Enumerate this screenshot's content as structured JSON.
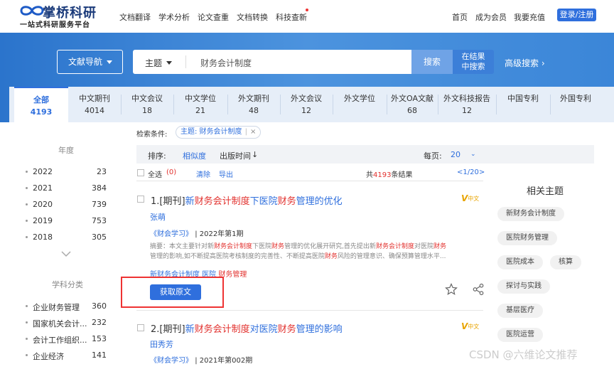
{
  "brand": {
    "name": "掌桥科研",
    "slogan": "一站式科研服务平台"
  },
  "nav": {
    "items": [
      "文档翻译",
      "学术分析",
      "论文查重",
      "文档转换",
      "科技查新"
    ],
    "right": [
      "首页",
      "成为会员",
      "我要充值"
    ],
    "login": "登录/注册"
  },
  "search": {
    "doc_nav": "文献导航",
    "field": "主题",
    "value": "财务会计制度",
    "search_btn": "搜索",
    "in_result_line1": "在结果",
    "in_result_line2": "中搜索",
    "advanced": "高级搜索"
  },
  "tabs": [
    {
      "label": "全部",
      "count": "4193"
    },
    {
      "label": "中文期刊",
      "count": "4014"
    },
    {
      "label": "中文会议",
      "count": "18"
    },
    {
      "label": "中文学位",
      "count": "21"
    },
    {
      "label": "外文期刊",
      "count": "48"
    },
    {
      "label": "外文会议",
      "count": "12"
    },
    {
      "label": "外文学位",
      "count": ""
    },
    {
      "label": "外文OA文献",
      "count": "68"
    },
    {
      "label": "外文科技报告",
      "count": "12"
    },
    {
      "label": "中国专利",
      "count": ""
    },
    {
      "label": "外国专利",
      "count": ""
    }
  ],
  "left": {
    "year_title": "年度",
    "years": [
      {
        "y": "2022",
        "c": "23"
      },
      {
        "y": "2021",
        "c": "384"
      },
      {
        "y": "2020",
        "c": "739"
      },
      {
        "y": "2019",
        "c": "753"
      },
      {
        "y": "2018",
        "c": "305"
      }
    ],
    "subject_title": "学科分类",
    "subjects": [
      {
        "s": "企业财务管理",
        "c": "360"
      },
      {
        "s": "国家机关会计...",
        "c": "232"
      },
      {
        "s": "会计工作组织...",
        "c": "153"
      },
      {
        "s": "企业经济",
        "c": "141"
      }
    ]
  },
  "filter": {
    "label": "检索条件:",
    "chip": "主题: 财务会计制度",
    "sort_label": "排序:",
    "sort_relevance": "相似度",
    "sort_time": "出版时间",
    "per_page_label": "每页:",
    "per_page": "20",
    "select_all": "全选",
    "selected_count": "(0)",
    "clear": "清除",
    "export": "导出",
    "total_prefix": "共",
    "total": "4193",
    "total_suffix": "条结果",
    "pager": "<1/20>"
  },
  "results": [
    {
      "index_type": "1.[期刊]",
      "title_parts": [
        {
          "t": "新",
          "c": "blue"
        },
        {
          "t": "财务会计制度",
          "c": "red"
        },
        {
          "t": "下医院",
          "c": "blue"
        },
        {
          "t": "财务",
          "c": "red"
        },
        {
          "t": "管理的优化",
          "c": "blue"
        }
      ],
      "author": "张萌",
      "journal": "《财会学习》",
      "issue": "| 2022年第1期",
      "abstract_l1": "摘要：本文主要针对新财务会计制度下医院财务管理的优化展开研究,首先提出新财务会计制度对医院财务",
      "abstract_l2": "管理的影响,如不断提高医院考核制度的完善性、不断提高医院财务风险的管理意识、确保预算管理水平...",
      "keywords": [
        "新财务会计制度",
        "医院",
        "财务管理"
      ],
      "get": "获取原文",
      "lang": "中文"
    },
    {
      "index_type": "2.[期刊]",
      "title_parts": [
        {
          "t": "新",
          "c": "blue"
        },
        {
          "t": "财务会计制度",
          "c": "red"
        },
        {
          "t": "对医院",
          "c": "blue"
        },
        {
          "t": "财务",
          "c": "red"
        },
        {
          "t": "管理的影响",
          "c": "blue"
        }
      ],
      "author": "田秀芳",
      "journal": "《财会学习》",
      "issue": "| 2021年第002期",
      "lang": "中文"
    }
  ],
  "related": {
    "title": "相关主题",
    "tags": [
      "新财务会计制度",
      "医院财务管理",
      "医院成本",
      "核算",
      "探讨与实践",
      "基层医疗",
      "医院运营"
    ]
  },
  "watermark": "CSDN @六维论文推荐"
}
